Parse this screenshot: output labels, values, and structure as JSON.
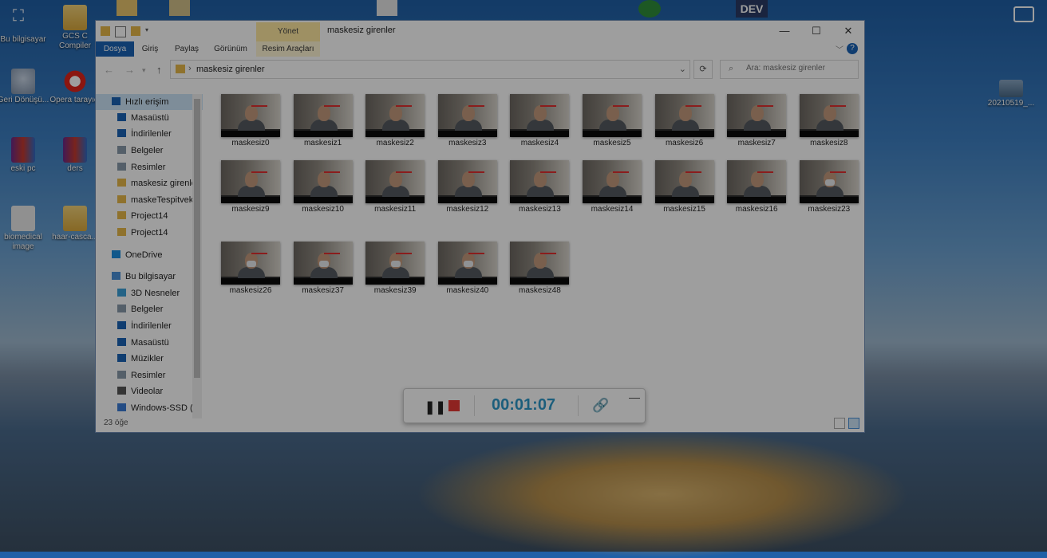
{
  "desktop": {
    "icons": [
      {
        "label": "Bu bilgisayar",
        "icon": "pc-icon"
      },
      {
        "label": "GCS C Compiler",
        "icon": "folder-icon"
      },
      {
        "label": "Geri Dönüşü...",
        "icon": "recycle-bin-icon"
      },
      {
        "label": "Opera tarayıcı",
        "icon": "opera-icon"
      },
      {
        "label": "eski pc",
        "icon": "winrar-icon"
      },
      {
        "label": "ders",
        "icon": "winrar-icon"
      },
      {
        "label": "biomedical image",
        "icon": "file-icon"
      },
      {
        "label": "haar-casca...",
        "icon": "folder-icon"
      },
      {
        "label": "20210519_...",
        "icon": "image-file-icon"
      }
    ],
    "top_label": "DEV"
  },
  "window": {
    "title": "maskesiz girenler",
    "manage_tab": "Yönet",
    "ribbon_tabs": [
      "Dosya",
      "Giriş",
      "Paylaş",
      "Görünüm",
      "Resim Araçları"
    ],
    "address_path": "maskesiz girenler",
    "search_placeholder": "Ara: maskesiz girenler",
    "status": "23 öğe"
  },
  "sidebar": {
    "items": [
      {
        "label": "Hızlı erişim",
        "icon": "star-icon",
        "selected": true
      },
      {
        "label": "Masaüstü",
        "icon": "desktop-icon",
        "pinned": true
      },
      {
        "label": "İndirilenler",
        "icon": "download-icon",
        "pinned": true
      },
      {
        "label": "Belgeler",
        "icon": "documents-icon",
        "pinned": true
      },
      {
        "label": "Resimler",
        "icon": "pictures-icon",
        "pinned": true
      },
      {
        "label": "maskesiz girenle",
        "icon": "folder-icon"
      },
      {
        "label": "maskeTespitvekt",
        "icon": "folder-icon"
      },
      {
        "label": "Project14",
        "icon": "folder-icon"
      },
      {
        "label": "Project14",
        "icon": "folder-icon"
      },
      {
        "label": "OneDrive",
        "icon": "cloud-icon"
      },
      {
        "label": "Bu bilgisayar",
        "icon": "pc-icon"
      },
      {
        "label": "3D Nesneler",
        "icon": "cube-icon"
      },
      {
        "label": "Belgeler",
        "icon": "documents-icon"
      },
      {
        "label": "İndirilenler",
        "icon": "download-icon"
      },
      {
        "label": "Masaüstü",
        "icon": "desktop-icon"
      },
      {
        "label": "Müzikler",
        "icon": "music-icon"
      },
      {
        "label": "Resimler",
        "icon": "pictures-icon"
      },
      {
        "label": "Videolar",
        "icon": "video-icon"
      },
      {
        "label": "Windows-SSD (C",
        "icon": "drive-icon"
      }
    ]
  },
  "files": [
    {
      "name": "maskesiz0",
      "masked": false
    },
    {
      "name": "maskesiz1",
      "masked": false
    },
    {
      "name": "maskesiz2",
      "masked": false
    },
    {
      "name": "maskesiz3",
      "masked": false
    },
    {
      "name": "maskesiz4",
      "masked": false
    },
    {
      "name": "maskesiz5",
      "masked": false
    },
    {
      "name": "maskesiz6",
      "masked": false
    },
    {
      "name": "maskesiz7",
      "masked": false
    },
    {
      "name": "maskesiz8",
      "masked": false
    },
    {
      "name": "maskesiz9",
      "masked": false
    },
    {
      "name": "maskesiz10",
      "masked": false
    },
    {
      "name": "maskesiz11",
      "masked": false
    },
    {
      "name": "maskesiz12",
      "masked": false
    },
    {
      "name": "maskesiz13",
      "masked": false
    },
    {
      "name": "maskesiz14",
      "masked": false
    },
    {
      "name": "maskesiz15",
      "masked": false
    },
    {
      "name": "maskesiz16",
      "masked": false
    },
    {
      "name": "maskesiz23",
      "masked": true
    },
    {
      "name": "maskesiz26",
      "masked": true
    },
    {
      "name": "maskesiz37",
      "masked": true
    },
    {
      "name": "maskesiz39",
      "masked": true
    },
    {
      "name": "maskesiz40",
      "masked": true
    },
    {
      "name": "maskesiz48",
      "masked": false
    }
  ],
  "recorder": {
    "time": "00:01:07",
    "pause_glyph": "❚❚",
    "link_glyph": "🔗",
    "minimize_glyph": "—",
    "stop_color": "#e53935",
    "time_color": "#2e98c8"
  },
  "colors": {
    "accent": "#1b63b5",
    "manage_tab_bg": "#ffe9a0",
    "selection": "#cce4f7"
  }
}
